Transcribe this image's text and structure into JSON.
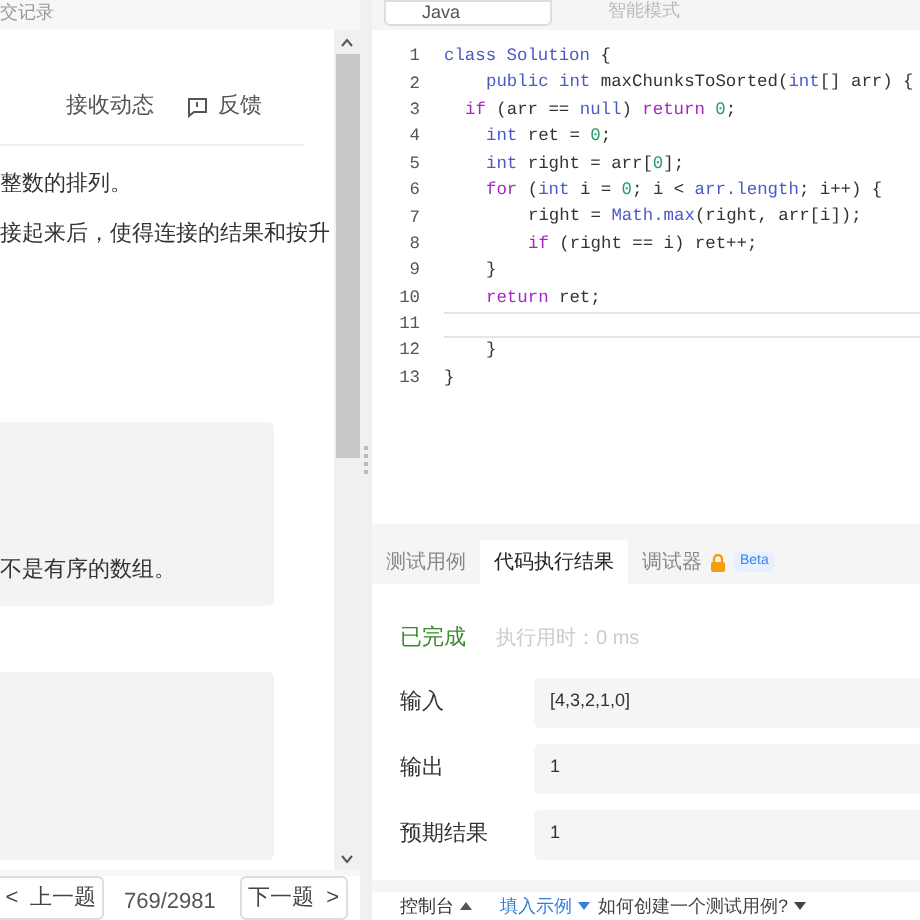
{
  "left_panel": {
    "header_text": "交记录",
    "tabs": [
      {
        "label": "接收动态",
        "icon": false
      },
      {
        "label": "反馈",
        "icon": true
      }
    ],
    "paragraphs": [
      "整数的排列。",
      "接起来后，使得连接的结果和按升"
    ],
    "example_boxes": [
      {
        "kind": "text",
        "text": "不是有序的数组。"
      },
      {
        "kind": "blank"
      }
    ],
    "pager": {
      "prev": "上一题",
      "position": "769/2981",
      "next": "下一题",
      "prev_glyph": "<",
      "next_glyph": ">"
    }
  },
  "editor": {
    "language": "Java",
    "mode": "智能模式",
    "lines": [
      {
        "number": "1",
        "kind": "indent0",
        "current": false,
        "tokens": [
          {
            "kind": "keyword",
            "text": "class "
          },
          {
            "kind": "type",
            "text": "Solution"
          },
          {
            "kind": "plain",
            "text": " {"
          }
        ]
      },
      {
        "number": "2",
        "kind": "indent2",
        "current": false,
        "tokens": [
          {
            "kind": "keyword",
            "text": "public int "
          },
          {
            "kind": "plain",
            "text": "maxChunksToSorted("
          },
          {
            "kind": "type",
            "text": "int"
          },
          {
            "kind": "plain",
            "text": "[] arr) {"
          }
        ]
      },
      {
        "number": "3",
        "kind": "indent1",
        "current": false,
        "tokens": [
          {
            "kind": "control",
            "text": "if "
          },
          {
            "kind": "plain",
            "text": "(arr == "
          },
          {
            "kind": "keyword",
            "text": "null"
          },
          {
            "kind": "plain",
            "text": ") "
          },
          {
            "kind": "control",
            "text": "return "
          },
          {
            "kind": "number",
            "text": "0"
          },
          {
            "kind": "plain",
            "text": ";"
          }
        ]
      },
      {
        "number": "4",
        "kind": "indent2",
        "current": false,
        "tokens": [
          {
            "kind": "type",
            "text": "int "
          },
          {
            "kind": "plain",
            "text": "ret = "
          },
          {
            "kind": "number",
            "text": "0"
          },
          {
            "kind": "plain",
            "text": ";"
          }
        ]
      },
      {
        "number": "5",
        "kind": "indent2",
        "current": false,
        "tokens": [
          {
            "kind": "type",
            "text": "int "
          },
          {
            "kind": "plain",
            "text": "right = arr["
          },
          {
            "kind": "number",
            "text": "0"
          },
          {
            "kind": "plain",
            "text": "];"
          }
        ]
      },
      {
        "number": "6",
        "kind": "indent2",
        "current": false,
        "tokens": [
          {
            "kind": "control",
            "text": "for "
          },
          {
            "kind": "plain",
            "text": "("
          },
          {
            "kind": "type",
            "text": "int "
          },
          {
            "kind": "plain",
            "text": "i = "
          },
          {
            "kind": "number",
            "text": "0"
          },
          {
            "kind": "plain",
            "text": "; i < "
          },
          {
            "kind": "keyword",
            "text": "arr.length"
          },
          {
            "kind": "plain",
            "text": "; i++) {"
          }
        ]
      },
      {
        "number": "7",
        "kind": "indent4",
        "current": false,
        "tokens": [
          {
            "kind": "plain",
            "text": "right = "
          },
          {
            "kind": "keyword",
            "text": "Math.max"
          },
          {
            "kind": "plain",
            "text": "(right, arr[i]);"
          }
        ]
      },
      {
        "number": "8",
        "kind": "indent4",
        "current": false,
        "tokens": [
          {
            "kind": "control",
            "text": "if "
          },
          {
            "kind": "plain",
            "text": "(right == i) ret++;"
          }
        ]
      },
      {
        "number": "9",
        "kind": "indent2",
        "current": false,
        "tokens": [
          {
            "kind": "plain",
            "text": "}"
          }
        ]
      },
      {
        "number": "10",
        "kind": "indent2",
        "current": false,
        "tokens": [
          {
            "kind": "control",
            "text": "return "
          },
          {
            "kind": "plain",
            "text": "ret;"
          }
        ]
      },
      {
        "number": "11",
        "kind": "indent0",
        "current": true
      },
      {
        "number": "12",
        "kind": "indent2",
        "current": false,
        "tokens": [
          {
            "kind": "plain",
            "text": "}"
          }
        ]
      },
      {
        "number": "13",
        "kind": "indent0",
        "current": false,
        "tokens": [
          {
            "kind": "plain",
            "text": "}"
          }
        ]
      }
    ]
  },
  "result_panel": {
    "tabs": [
      {
        "label": "测试用例",
        "selected": false,
        "locked": false
      },
      {
        "label": "代码执行结果",
        "selected": true,
        "locked": false
      },
      {
        "label": "调试器",
        "selected": false,
        "locked": true,
        "badge": "Beta"
      }
    ],
    "status": "已完成",
    "runtime": "执行用时：0 ms",
    "rows": [
      {
        "label": "输入",
        "value": "[4,3,2,1,0]"
      },
      {
        "label": "输出",
        "value": "1"
      },
      {
        "label": "预期结果",
        "value": "1"
      }
    ],
    "footer": {
      "console": "控制台",
      "fill_example": "填入示例",
      "help": "如何创建一个测试用例?"
    }
  }
}
